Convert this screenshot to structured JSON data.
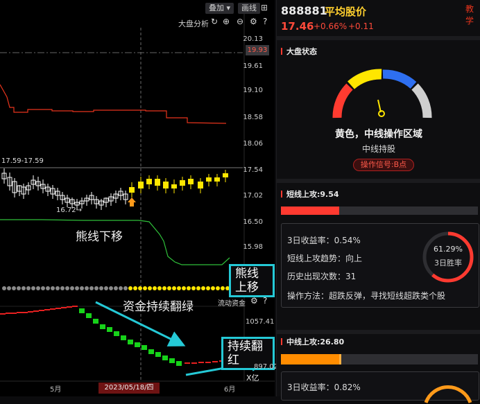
{
  "toolbar": {
    "overlay_label": "叠加",
    "draw_label": "画线",
    "market_analysis_label": "大盘分析"
  },
  "chart": {
    "current_price_box": "19.93",
    "y_axis_labels": [
      "20.13",
      "19.61",
      "19.10",
      "18.58",
      "18.06",
      "17.54",
      "17.02",
      "16.50",
      "15.98"
    ],
    "range_label": "17.59-17.59",
    "low_marker": "16.72→",
    "bear_down_text": "熊线下移",
    "bear_up_text": "熊线上移",
    "capital_green_text": "资金持续翻绿",
    "capital_red_text": "持续翻红",
    "flow_label": "流动资金",
    "flow_axis_labels": [
      "1057.41",
      "897.02"
    ],
    "flow_unit": "X亿",
    "x_labels": [
      "5月",
      "6月"
    ],
    "selected_date": "2023/05/18/四",
    "colors": {
      "up": "#ffe600",
      "down": "#ffffff",
      "price_line": "#e8341c",
      "bear_line": "#2fbf3a",
      "flow_down": "#17d21a",
      "flow_up": "#e82020",
      "arrow": "#25c9d6"
    }
  },
  "panel": {
    "code": "888881",
    "name": "平均股价",
    "teach_label": "教学",
    "price": "17.46",
    "change_pct": "+0.66%",
    "change_abs": "+0.11",
    "market_state_title": "大盘状态",
    "gauge_text": "黄色，中线操作区域",
    "gauge_sub": "中线持股",
    "signal_badge": "操作信号:B点",
    "short_title": "短线上攻:9.54",
    "short_progress": 0.0954,
    "short_rows": [
      "3日收益率：0.54%",
      "短线上攻趋势：向上",
      "历史出现次数：31",
      "操作方法：超跌反弹，寻找短线超跌类个股"
    ],
    "short_winrate": "61.29%",
    "short_winrate_value": 0.6129,
    "short_winrate_label": "3日胜率",
    "mid_title": "中线上攻:26.80",
    "mid_progress": 0.268,
    "mid_rows": [
      "3日收益率：0.82%"
    ]
  }
}
